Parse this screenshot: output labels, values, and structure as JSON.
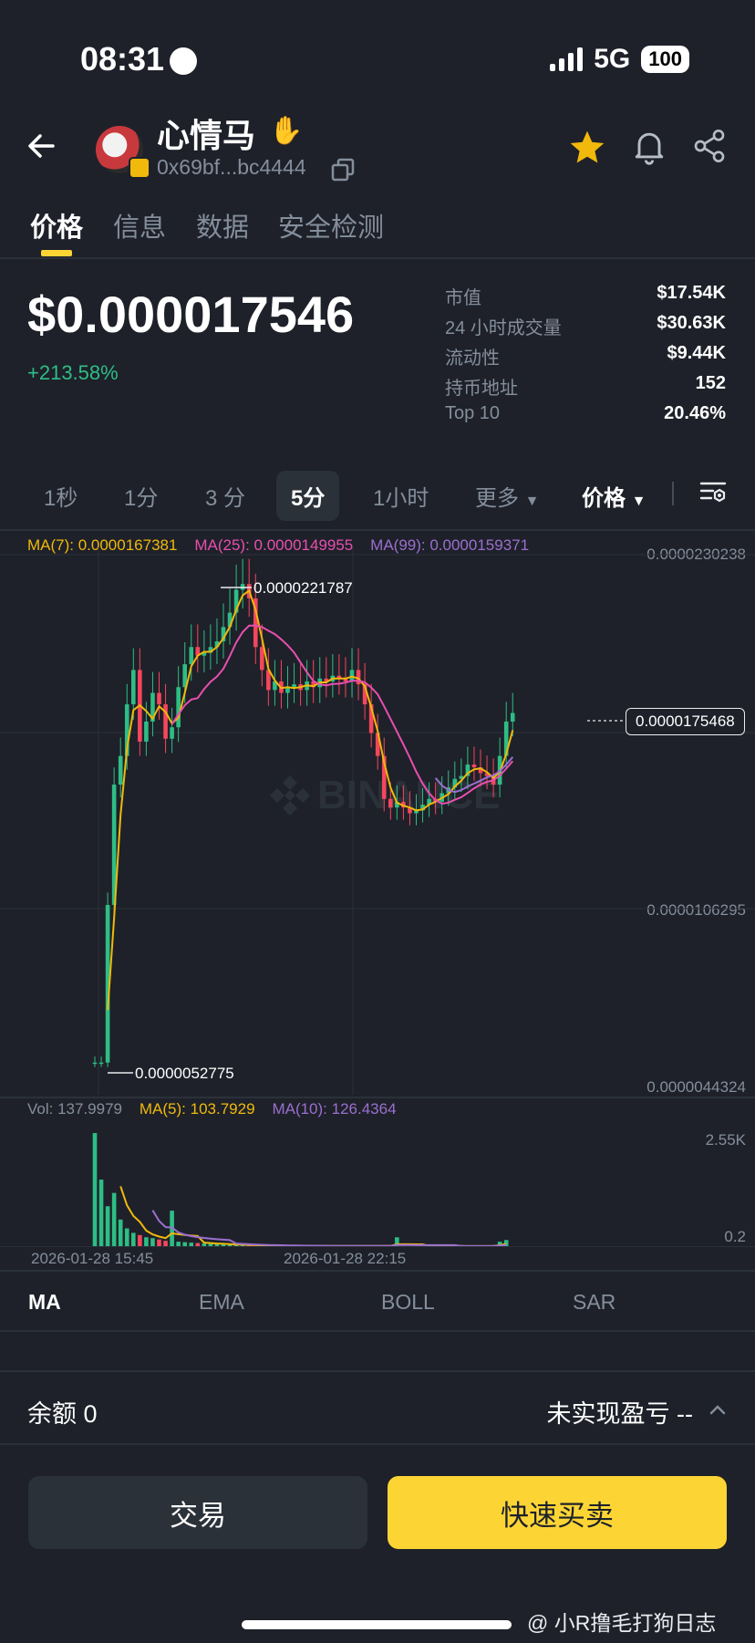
{
  "status_bar": {
    "time": "08:31",
    "network": "5G",
    "battery": "100"
  },
  "header": {
    "token_name": "心情马",
    "address": "0x69bf...bc4444"
  },
  "tabs": [
    {
      "label": "价格",
      "active": true
    },
    {
      "label": "信息"
    },
    {
      "label": "数据"
    },
    {
      "label": "安全检测"
    }
  ],
  "price": {
    "value": "$0.000017546",
    "change": "+213.58%"
  },
  "stats": [
    {
      "label": "市值",
      "value": "$17.54K"
    },
    {
      "label": "24 小时成交量",
      "value": "$30.63K"
    },
    {
      "label": "流动性",
      "value": "$9.44K"
    },
    {
      "label": "持币地址",
      "value": "152"
    },
    {
      "label": "Top 10",
      "value": "20.46%"
    }
  ],
  "intervals": [
    "1秒",
    "1分",
    "3 分",
    "5分",
    "1小时",
    "更多",
    "价格"
  ],
  "active_interval": "5分",
  "ma_legend": {
    "ma7": "MA(7): 0.0000167381",
    "ma25": "MA(25): 0.0000149955",
    "ma99": "MA(99): 0.0000159371"
  },
  "price_axis": {
    "top": "0.0000230238",
    "mid": "0.0000106295",
    "bottom": "0.0000044324",
    "high_marker": "0.0000221787",
    "low_marker": "0.0000052775",
    "current": "0.0000175468"
  },
  "watermark_logo": "BINANCE",
  "volume_legend": {
    "vol": "Vol: 137.9979",
    "ma5": "MA(5): 103.7929",
    "ma10": "MA(10): 126.4364"
  },
  "volume_axis": {
    "top": "2.55K",
    "bottom": "0.2"
  },
  "time_axis": [
    "2026-01-28 15:45",
    "2026-01-28 22:15"
  ],
  "indicators": [
    "MA",
    "EMA",
    "BOLL",
    "SAR"
  ],
  "balance": "余额 0",
  "unrealized": "未实现盈亏 --",
  "buttons": {
    "trade": "交易",
    "quick": "快速买卖"
  },
  "watermark_text": "@ 小R撸毛打狗日志",
  "colors": {
    "background": "#1e2129",
    "up": "#2ebd85",
    "down": "#f6465d",
    "ma7": "#f0b90b",
    "ma25": "#e84fb0",
    "ma99": "#9b6fd0",
    "accent": "#fcd535"
  },
  "chart_data": {
    "type": "candlestick",
    "x_start": "2026-01-28 15:45",
    "interval": "5m",
    "ylim": [
      4.4324e-06,
      2.30238e-05
    ],
    "close": [
      5.3e-06,
      5.3e-06,
      1.08e-05,
      1.5e-05,
      1.6e-05,
      1.78e-05,
      1.9e-05,
      1.65e-05,
      1.72e-05,
      1.82e-05,
      1.78e-05,
      1.66e-05,
      1.7e-05,
      1.84e-05,
      1.92e-05,
      1.98e-05,
      1.95e-05,
      1.96e-05,
      1.98e-05,
      2e-05,
      2.05e-05,
      2.1e-05,
      2.18e-05,
      2.2e-05,
      2.15e-05,
      1.98e-05,
      1.9e-05,
      1.83e-05,
      1.86e-05,
      1.82e-05,
      1.84e-05,
      1.85e-05,
      1.83e-05,
      1.86e-05,
      1.84e-05,
      1.87e-05,
      1.86e-05,
      1.88e-05,
      1.87e-05,
      1.86e-05,
      1.9e-05,
      1.85e-05,
      1.78e-05,
      1.68e-05,
      1.6e-05,
      1.45e-05,
      1.42e-05,
      1.44e-05,
      1.42e-05,
      1.4e-05,
      1.41e-05,
      1.43e-05,
      1.45e-05,
      1.44e-05,
      1.47e-05,
      1.49e-05,
      1.52e-05,
      1.53e-05,
      1.57e-05,
      1.56e-05,
      1.54e-05,
      1.53e-05,
      1.5e-05,
      1.6e-05,
      1.72e-05,
      1.75e-05
    ],
    "volume_values_approx": [
      2550,
      1500,
      900,
      1200,
      600,
      400,
      300,
      250,
      200,
      180,
      150,
      120,
      800,
      100,
      90,
      80,
      70,
      60,
      50,
      40,
      45,
      30,
      25,
      20,
      18,
      15,
      14,
      12,
      10,
      9,
      8,
      8,
      7,
      6,
      6,
      5,
      5,
      4,
      4,
      5,
      6,
      7,
      5,
      4,
      4,
      3,
      3,
      200,
      3,
      2,
      2,
      2,
      3,
      4,
      5,
      3,
      2,
      2,
      2,
      3,
      2,
      2,
      2,
      100,
      138
    ]
  }
}
